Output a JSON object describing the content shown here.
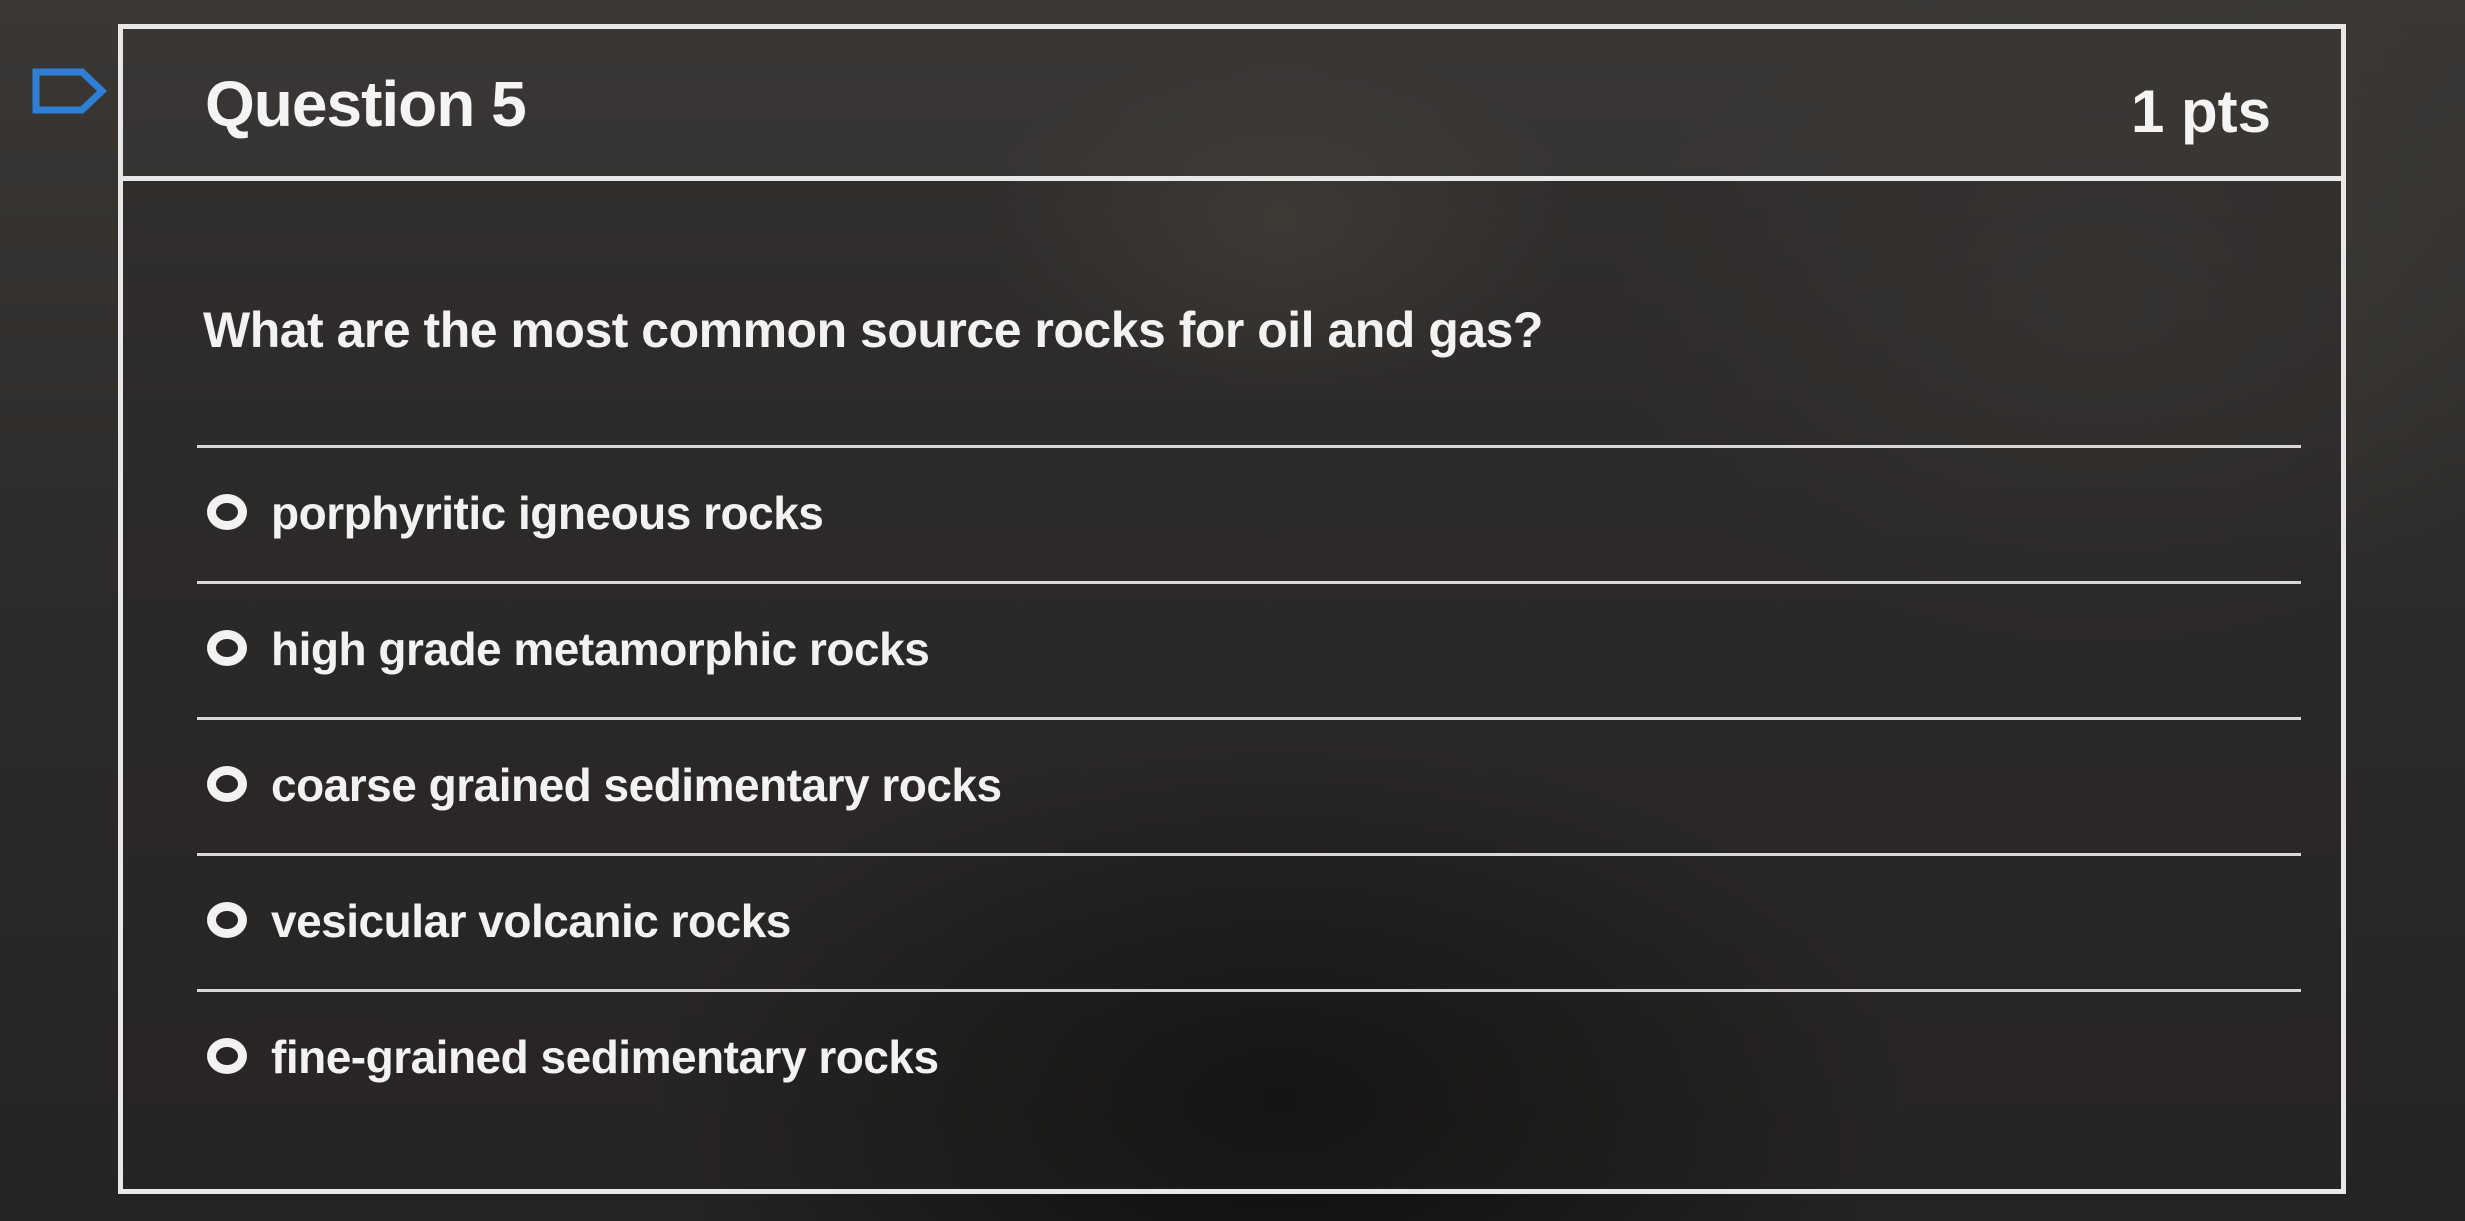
{
  "question": {
    "title": "Question 5",
    "points": "1 pts",
    "text": "What are the most common source rocks for oil and gas?",
    "flag_icon": "flag-outline-icon"
  },
  "answers": [
    {
      "label": "porphyritic igneous rocks",
      "selected": false
    },
    {
      "label": "high grade metamorphic rocks",
      "selected": false
    },
    {
      "label": "coarse grained sedimentary rocks",
      "selected": false
    },
    {
      "label": "vesicular volcanic rocks",
      "selected": false
    },
    {
      "label": "fine-grained sedimentary rocks",
      "selected": false
    }
  ],
  "colors": {
    "border": "#e8e8e8",
    "text": "#f2f2f2",
    "background": "#2c2a28"
  }
}
